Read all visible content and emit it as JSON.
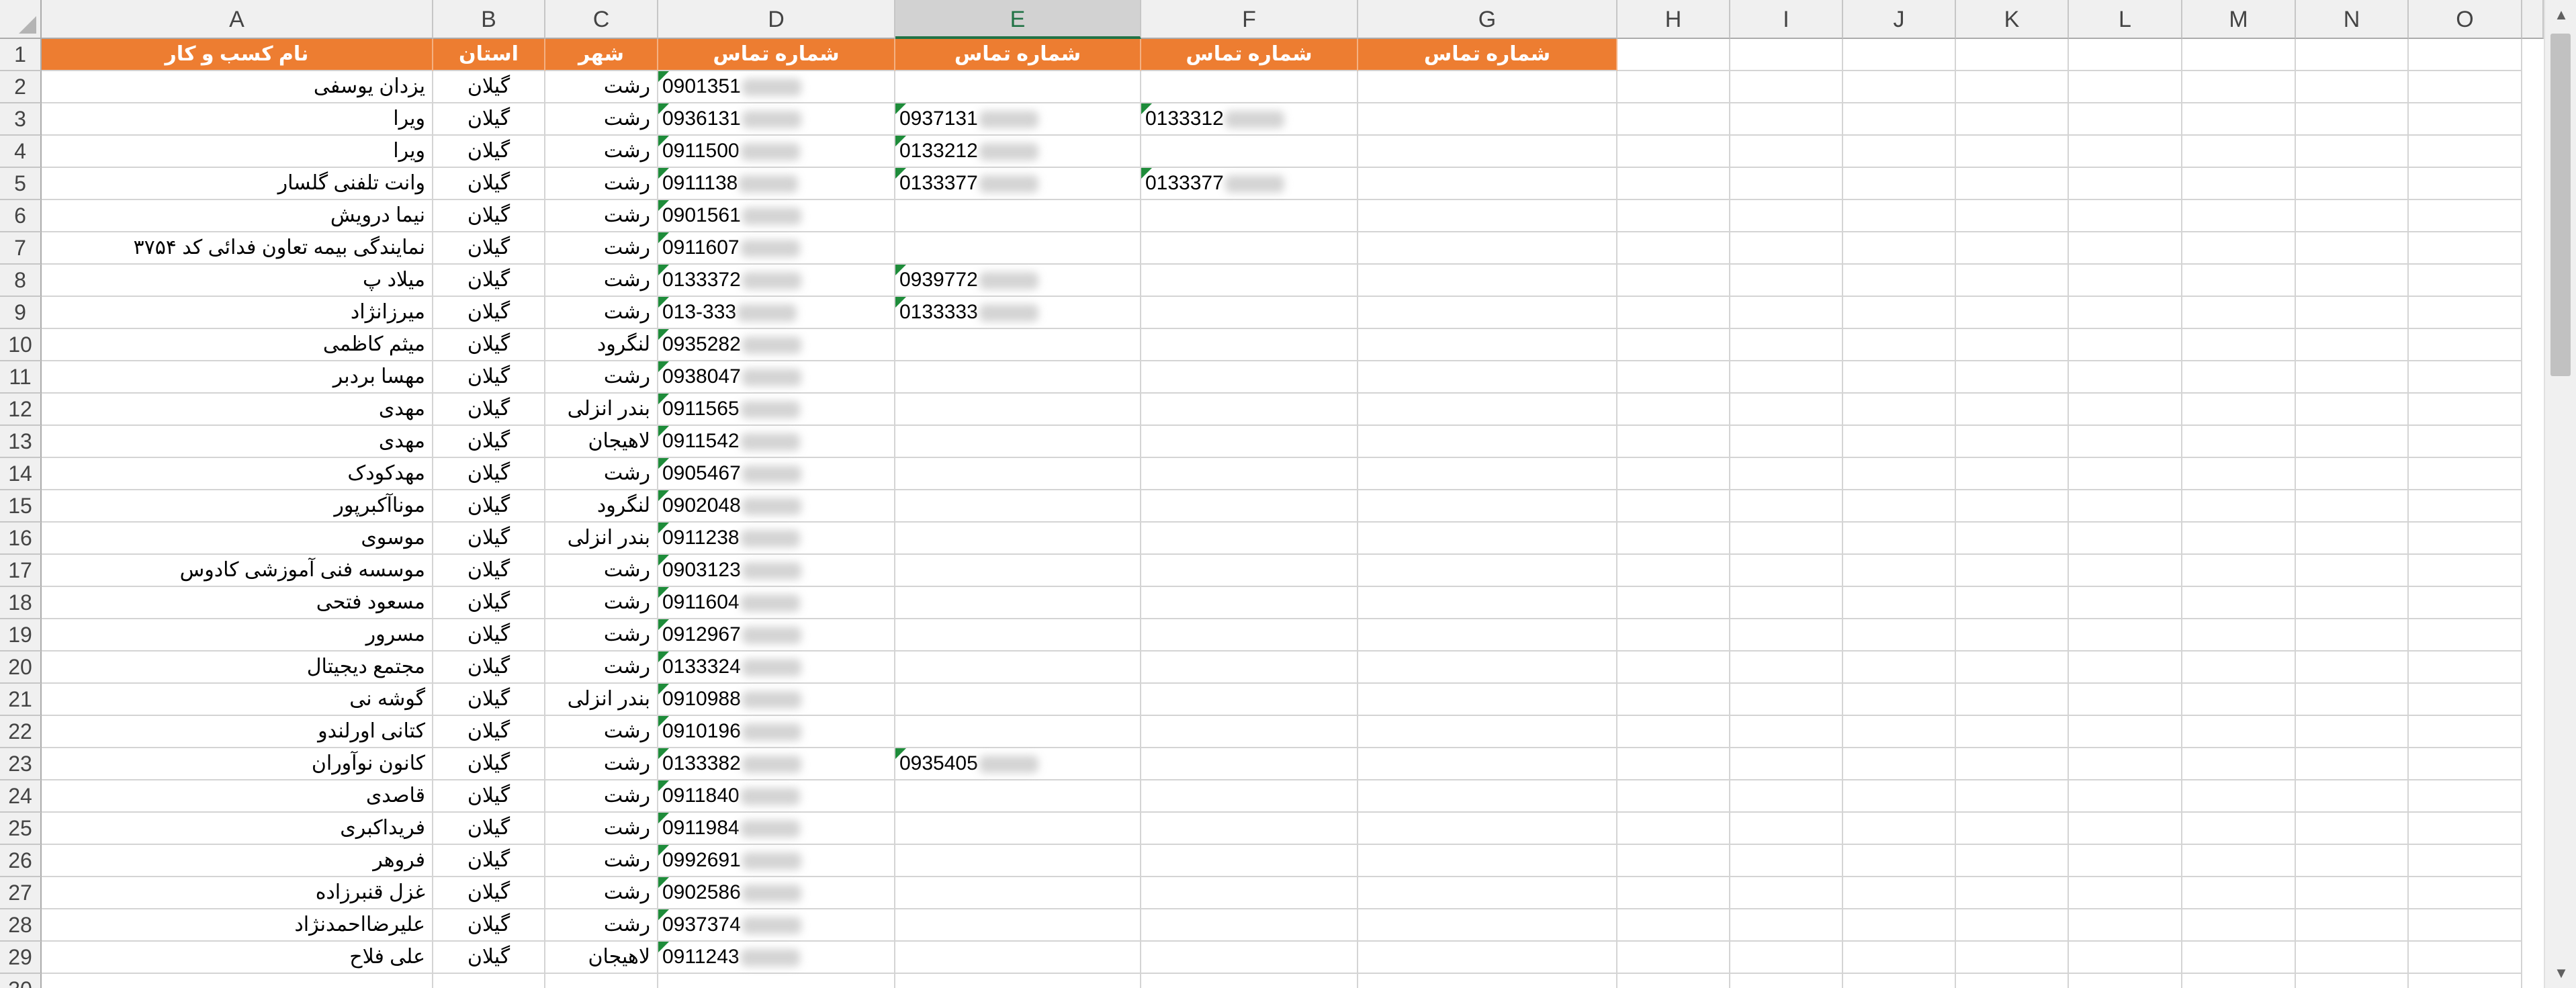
{
  "columns": [
    "A",
    "B",
    "C",
    "D",
    "E",
    "F",
    "G",
    "H",
    "I",
    "J",
    "K",
    "L",
    "M",
    "N",
    "O"
  ],
  "selected_column": "E",
  "header_row": [
    "نام کسب و کار",
    "استان",
    "شهر",
    "شماره تماس",
    "شماره تماس",
    "شماره تماس",
    "شماره تماس"
  ],
  "rows": [
    {
      "n": "2",
      "a": "یزدان یوسفی",
      "b": "گیلان",
      "c": "رشت",
      "d": "0901351",
      "e": "",
      "f": ""
    },
    {
      "n": "3",
      "a": "ویرا",
      "b": "گیلان",
      "c": "رشت",
      "d": "0936131",
      "e": "0937131",
      "f": "0133312"
    },
    {
      "n": "4",
      "a": "ویرا",
      "b": "گیلان",
      "c": "رشت",
      "d": "0911500",
      "e": "0133212",
      "f": ""
    },
    {
      "n": "5",
      "a": "وانت تلفنی گلسار",
      "b": "گیلان",
      "c": "رشت",
      "d": "0911138",
      "e": "0133377",
      "f": "0133377"
    },
    {
      "n": "6",
      "a": "نیما درویش",
      "b": "گیلان",
      "c": "رشت",
      "d": "0901561",
      "e": "",
      "f": ""
    },
    {
      "n": "7",
      "a": "نمایندگی بیمه تعاون فدائی کد ۳۷۵۴",
      "b": "گیلان",
      "c": "رشت",
      "d": "0911607",
      "e": "",
      "f": ""
    },
    {
      "n": "8",
      "a": "میلاد پ",
      "b": "گیلان",
      "c": "رشت",
      "d": "0133372",
      "e": "0939772",
      "f": ""
    },
    {
      "n": "9",
      "a": "میرزانژاد",
      "b": "گیلان",
      "c": "رشت",
      "d": "013-333",
      "e": "0133333",
      "f": ""
    },
    {
      "n": "10",
      "a": "میثم کاظمی",
      "b": "گیلان",
      "c": "لنگرود",
      "d": "0935282",
      "e": "",
      "f": ""
    },
    {
      "n": "11",
      "a": "مهسا بردبر",
      "b": "گیلان",
      "c": "رشت",
      "d": "0938047",
      "e": "",
      "f": ""
    },
    {
      "n": "12",
      "a": "مهدی",
      "b": "گیلان",
      "c": "بندر انزلی",
      "d": "0911565",
      "e": "",
      "f": ""
    },
    {
      "n": "13",
      "a": "مهدی",
      "b": "گیلان",
      "c": "لاهیجان",
      "d": "0911542",
      "e": "",
      "f": ""
    },
    {
      "n": "14",
      "a": "مهدکودک",
      "b": "گیلان",
      "c": "رشت",
      "d": "0905467",
      "e": "",
      "f": ""
    },
    {
      "n": "15",
      "a": "موناآکبرپور",
      "b": "گیلان",
      "c": "لنگرود",
      "d": "0902048",
      "e": "",
      "f": ""
    },
    {
      "n": "16",
      "a": "موسوی",
      "b": "گیلان",
      "c": "بندر انزلی",
      "d": "0911238",
      "e": "",
      "f": ""
    },
    {
      "n": "17",
      "a": "موسسه فنی آموزشی کادوس",
      "b": "گیلان",
      "c": "رشت",
      "d": "0903123",
      "e": "",
      "f": ""
    },
    {
      "n": "18",
      "a": "مسعود فتحی",
      "b": "گیلان",
      "c": "رشت",
      "d": "0911604",
      "e": "",
      "f": ""
    },
    {
      "n": "19",
      "a": "مسرور",
      "b": "گیلان",
      "c": "رشت",
      "d": "0912967",
      "e": "",
      "f": ""
    },
    {
      "n": "20",
      "a": "مجتمع دیجیتال",
      "b": "گیلان",
      "c": "رشت",
      "d": "0133324",
      "e": "",
      "f": ""
    },
    {
      "n": "21",
      "a": "گوشه نی",
      "b": "گیلان",
      "c": "بندر انزلی",
      "d": "0910988",
      "e": "",
      "f": ""
    },
    {
      "n": "22",
      "a": "کتانی اورلندو",
      "b": "گیلان",
      "c": "رشت",
      "d": "0910196",
      "e": "",
      "f": ""
    },
    {
      "n": "23",
      "a": "کانون نوآوران",
      "b": "گیلان",
      "c": "رشت",
      "d": "0133382",
      "e": "0935405",
      "f": ""
    },
    {
      "n": "24",
      "a": "قاصدی",
      "b": "گیلان",
      "c": "رشت",
      "d": "0911840",
      "e": "",
      "f": ""
    },
    {
      "n": "25",
      "a": "فریداکبری",
      "b": "گیلان",
      "c": "رشت",
      "d": "0911984",
      "e": "",
      "f": ""
    },
    {
      "n": "26",
      "a": "فروهر",
      "b": "گیلان",
      "c": "رشت",
      "d": "0992691",
      "e": "",
      "f": ""
    },
    {
      "n": "27",
      "a": "غزل قنبرزاده",
      "b": "گیلان",
      "c": "رشت",
      "d": "0902586",
      "e": "",
      "f": ""
    },
    {
      "n": "28",
      "a": "علیرضااحمدنژاد",
      "b": "گیلان",
      "c": "رشت",
      "d": "0937374",
      "e": "",
      "f": ""
    },
    {
      "n": "29",
      "a": "علی فلاح",
      "b": "گیلان",
      "c": "لاهیجان",
      "d": "0911243",
      "e": "",
      "f": ""
    }
  ],
  "scroll": {
    "up": "▲",
    "down": "▼"
  }
}
